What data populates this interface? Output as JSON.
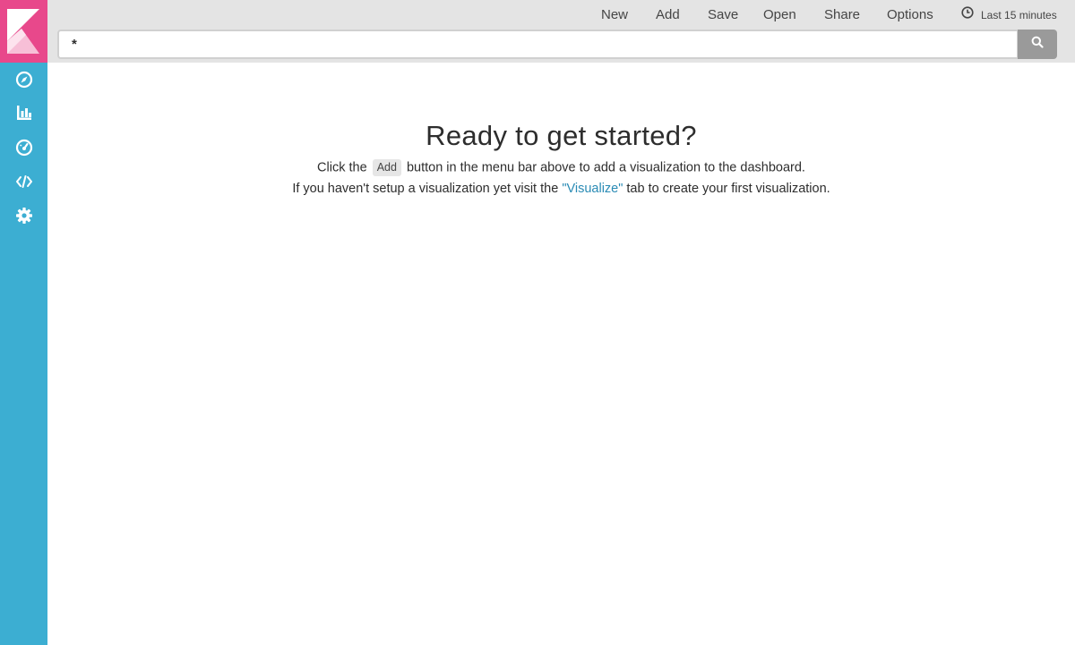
{
  "menu": {
    "items": [
      "New",
      "Add",
      "Save",
      "Open",
      "Share",
      "Options"
    ],
    "time_range": "Last 15 minutes"
  },
  "search": {
    "value": "*"
  },
  "sidebar": {
    "items": [
      {
        "icon": "compass-icon"
      },
      {
        "icon": "bar-chart-icon"
      },
      {
        "icon": "gauge-icon"
      },
      {
        "icon": "code-icon"
      },
      {
        "icon": "gear-icon"
      }
    ]
  },
  "main": {
    "heading": "Ready to get started?",
    "line1_before": "Click the",
    "line1_button": "Add",
    "line1_after": "button in the menu bar above to add a visualization to the dashboard.",
    "line2_before": "If you haven't setup a visualization yet visit the",
    "line2_link": "\"Visualize\"",
    "line2_after": "tab to create your first visualization."
  },
  "colors": {
    "sidebar": "#3caed2",
    "logo": "#e8488b",
    "topbar": "#e4e4e4",
    "link": "#2a8bb5"
  }
}
